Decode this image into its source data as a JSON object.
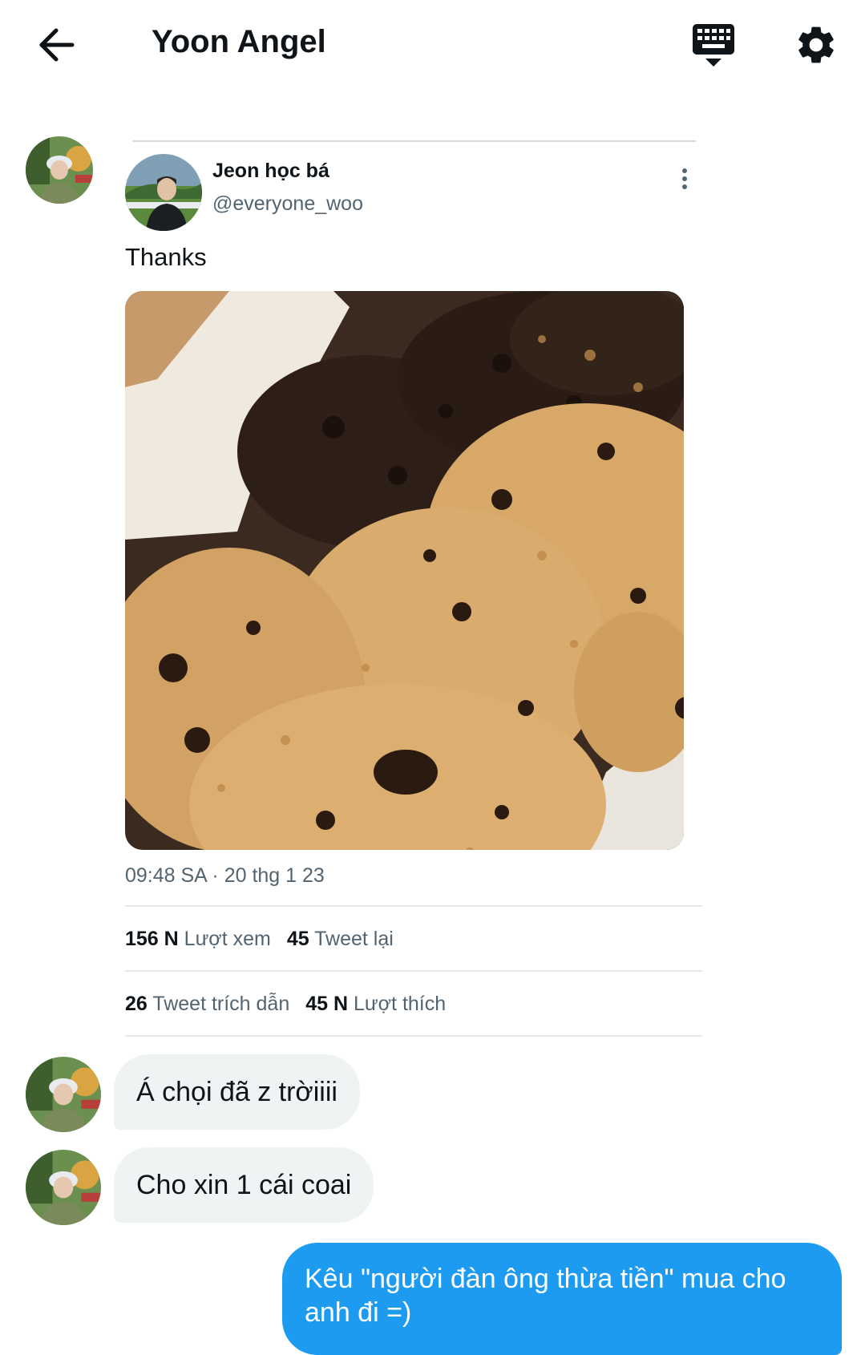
{
  "header": {
    "title": "Yoon Angel",
    "back_icon": "arrow-left-icon",
    "keyboard_icon": "keyboard-icon",
    "settings_icon": "gear-icon"
  },
  "tweet": {
    "author_name": "Jeon học bá",
    "author_handle": "@everyone_woo",
    "text": "Thanks",
    "media_description_icon": "cookies-photo",
    "timestamp": "09:48 SA · 20 thg 1 23",
    "stats_row1": {
      "views_count": "156 N",
      "views_label": "Lượt xem",
      "retweets_count": "45",
      "retweets_label": "Tweet lại"
    },
    "stats_row2": {
      "quotes_count": "26",
      "quotes_label": "Tweet trích dẫn",
      "likes_count": "45 N",
      "likes_label": "Lượt thích"
    }
  },
  "messages": [
    {
      "direction": "incoming",
      "text": "Á chọi đã z trờiiii"
    },
    {
      "direction": "incoming",
      "text": "Cho xin 1 cái coai"
    },
    {
      "direction": "outgoing",
      "text": "Kêu \"người đàn ông thừa tiền\" mua cho anh đi =)"
    }
  ],
  "colors": {
    "accent": "#1d9bf0",
    "incoming_bubble": "#eff3f4",
    "secondary_text": "#536471",
    "primary_text": "#0f1419"
  }
}
